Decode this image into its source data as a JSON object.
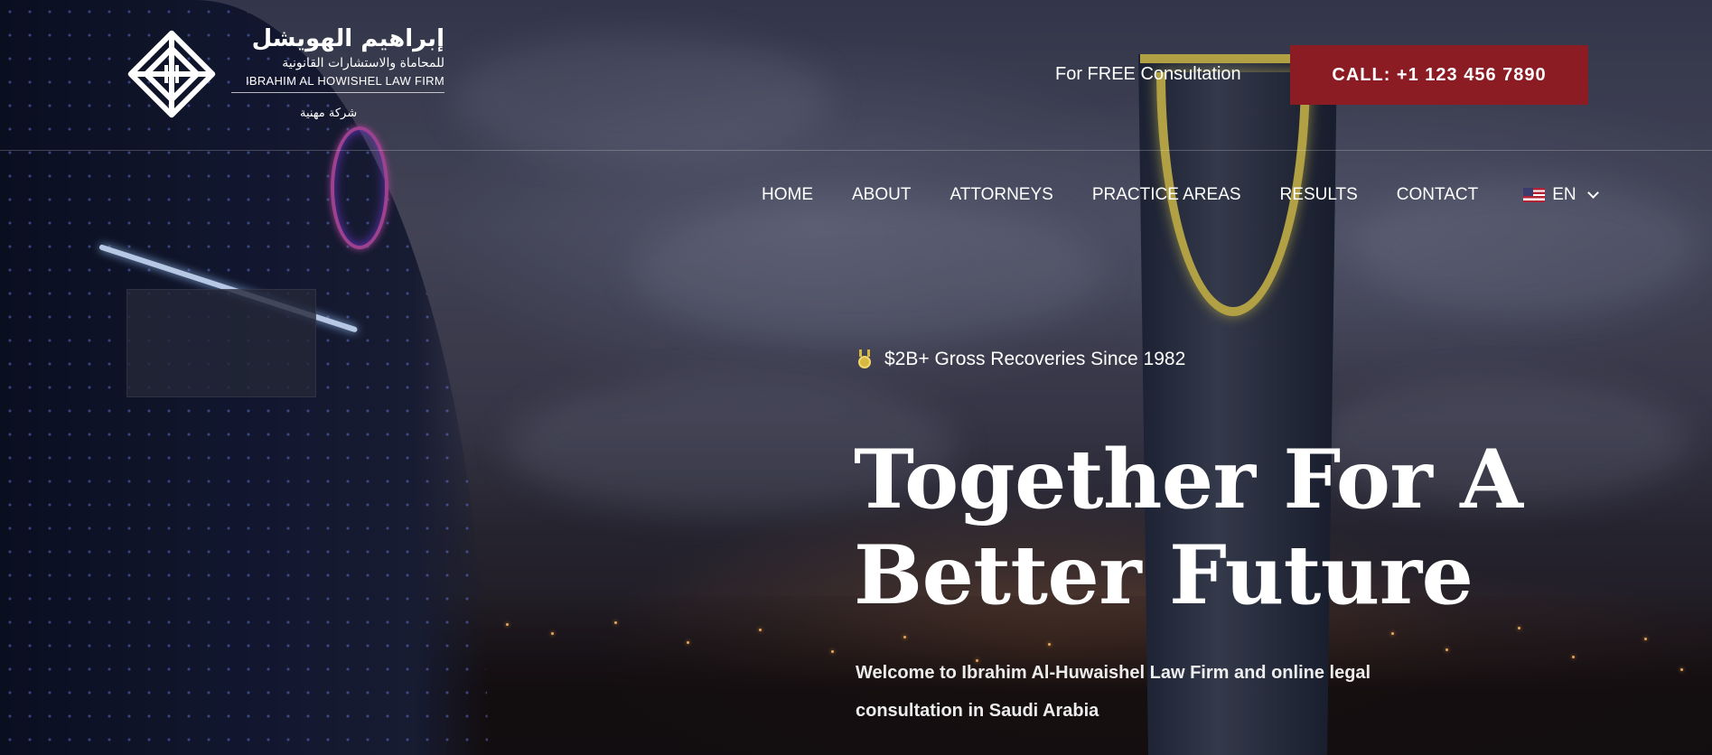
{
  "logo": {
    "arabic_name": "إبراهيم الهويشل",
    "arabic_subtitle": "للمحاماة والاستشارات القانونية",
    "english_name": "IBRAHIM AL HOWISHEL LAW FIRM",
    "arabic_tagline": "شركة مهنية"
  },
  "header": {
    "consultation_text": "For FREE Consultation",
    "call_button_label": "CALL: +1 123 456 7890",
    "call_button_color": "#8c1c24"
  },
  "nav": {
    "items": [
      {
        "label": "HOME"
      },
      {
        "label": "ABOUT"
      },
      {
        "label": "ATTORNEYS"
      },
      {
        "label": "PRACTICE AREAS"
      },
      {
        "label": "RESULTS"
      },
      {
        "label": "CONTACT"
      }
    ],
    "language": {
      "label": "EN",
      "flag": "us-flag-icon"
    }
  },
  "hero": {
    "badge_icon": "medal-icon",
    "badge_text": "$2B+ Gross Recoveries Since 1982",
    "title_line1": "Together For A",
    "title_line2": "Better Future",
    "subtitle": "Welcome to Ibrahim Al-Huwaishel Law Firm and online legal consultation in Saudi Arabia"
  }
}
